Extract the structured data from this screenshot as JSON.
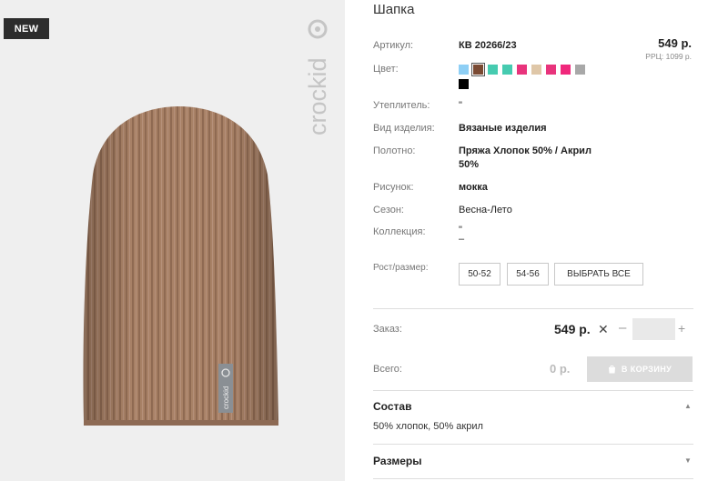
{
  "image": {
    "badge": "NEW",
    "brand": "crockid",
    "alt_icon": "knit-hat-photo"
  },
  "product": {
    "title": "Шапка",
    "article_label": "Артикул:",
    "article_value": "КВ 20266/23",
    "price": "549 р.",
    "rrp": "РРЦ: 1099 р.",
    "color_label": "Цвет:",
    "swatches": [
      "#8ecff5",
      "#7a4a33",
      "#46cbb0",
      "#46cbb0",
      "#e8347c",
      "#dfc7a8",
      "#e8347c",
      "#f0287c",
      "#a8a8a8",
      "#000000"
    ],
    "selected_swatch_index": 1,
    "insulation_label": "Утеплитель:",
    "insulation_value": "\"",
    "type_label": "Вид изделия:",
    "type_value": "Вязаные изделия",
    "fabric_label": "Полотно:",
    "fabric_value_line1": "Пряжа Хлопок 50% / Акрил",
    "fabric_value_line2": "50%",
    "pattern_label": "Рисунок:",
    "pattern_value": "мокка",
    "season_label": "Сезон:",
    "season_value": "Весна-Лето",
    "collection_label": "Коллекция:",
    "collection_value_line1": "\"",
    "collection_value_line2": "–",
    "size_label": "Рост/размер:",
    "sizes": [
      "50-52",
      "54-56"
    ],
    "select_all": "ВЫБРАТЬ ВСЕ"
  },
  "order": {
    "label": "Заказ:",
    "price": "549 р.",
    "times": "✕",
    "minus": "–",
    "plus": "+",
    "qty": ""
  },
  "total": {
    "label": "Всего:",
    "value": "0 р.",
    "cart_button": "В КОРЗИНУ"
  },
  "composition": {
    "title": "Состав",
    "text": "50% хлопок, 50% акрил",
    "arrow": "▲"
  },
  "sizes_section": {
    "title": "Размеры",
    "arrow": "▼"
  }
}
